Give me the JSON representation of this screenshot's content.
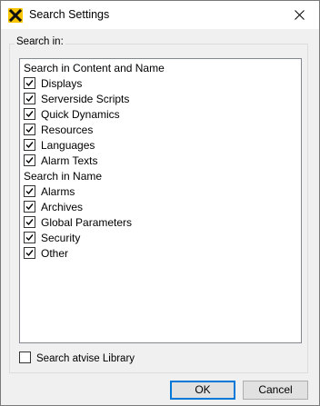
{
  "window": {
    "title": "Search Settings",
    "icon": "atvise-logo-icon",
    "accent": "#f6c500"
  },
  "group": {
    "label": "Search in:"
  },
  "list": {
    "sections": [
      {
        "header": "Search in Content and Name",
        "items": [
          {
            "label": "Displays",
            "checked": true
          },
          {
            "label": "Serverside Scripts",
            "checked": true
          },
          {
            "label": "Quick Dynamics",
            "checked": true
          },
          {
            "label": "Resources",
            "checked": true
          },
          {
            "label": "Languages",
            "checked": true
          },
          {
            "label": "Alarm Texts",
            "checked": true
          }
        ]
      },
      {
        "header": "Search in Name",
        "items": [
          {
            "label": "Alarms",
            "checked": true
          },
          {
            "label": "Archives",
            "checked": true
          },
          {
            "label": "Global Parameters",
            "checked": true
          },
          {
            "label": "Security",
            "checked": true
          },
          {
            "label": "Other",
            "checked": true
          }
        ]
      }
    ]
  },
  "library": {
    "label": "Search atvise Library",
    "checked": false
  },
  "buttons": {
    "ok": "OK",
    "cancel": "Cancel"
  }
}
